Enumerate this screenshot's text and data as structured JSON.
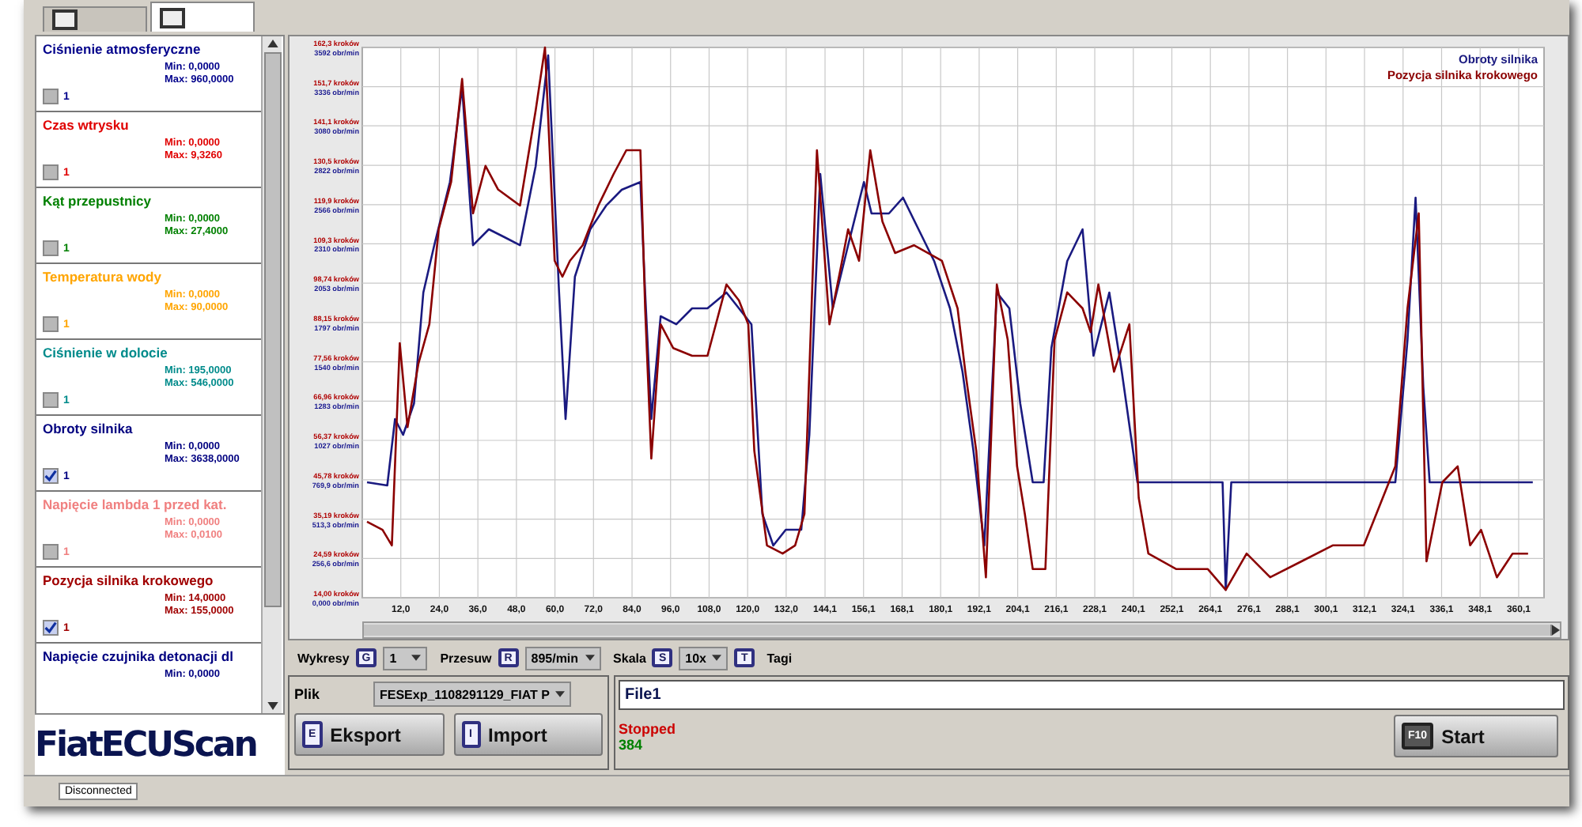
{
  "tabs": [
    {
      "selected": false
    },
    {
      "selected": true
    }
  ],
  "sensors": [
    {
      "name": "Ciśnienie atmosferyczne",
      "color": "#00008b",
      "min": "Min: 0,0000",
      "max": "Max: 960,0000",
      "checked": false,
      "channel": "1"
    },
    {
      "name": "Czas wtrysku",
      "color": "#e00000",
      "min": "Min: 0,0000",
      "max": "Max: 9,3260",
      "checked": false,
      "channel": "1"
    },
    {
      "name": "Kąt przepustnicy",
      "color": "#008000",
      "min": "Min: 0,0000",
      "max": "Max: 27,4000",
      "checked": false,
      "channel": "1"
    },
    {
      "name": "Temperatura wody",
      "color": "#ffa500",
      "min": "Min: 0,0000",
      "max": "Max: 90,0000",
      "checked": false,
      "channel": "1"
    },
    {
      "name": "Ciśnienie w dolocie",
      "color": "#008b8b",
      "min": "Min: 195,0000",
      "max": "Max: 546,0000",
      "checked": false,
      "channel": "1"
    },
    {
      "name": "Obroty silnika",
      "color": "#000080",
      "min": "Min: 0,0000",
      "max": "Max: 3638,0000",
      "checked": true,
      "channel": "1"
    },
    {
      "name": "Napięcie lambda 1 przed kat.",
      "color": "#f08080",
      "min": "Min: 0,0000",
      "max": "Max: 0,0100",
      "checked": false,
      "channel": "1"
    },
    {
      "name": "Pozycja silnika krokowego",
      "color": "#a00000",
      "min": "Min: 14,0000",
      "max": "Max: 155,0000",
      "checked": true,
      "channel": "1"
    },
    {
      "name": "Napięcie czujnika detonacji dl",
      "color": "#000080",
      "min": "Min: 0,0000"
    }
  ],
  "logo": "FiatECUScan",
  "chart": {
    "chart_data": {
      "type": "line",
      "grid": true,
      "xlim": [
        0,
        368
      ],
      "ylim": [
        0,
        3592
      ],
      "y2lim": [
        14,
        162.3
      ],
      "xticks": [
        {
          "value": 12,
          "label": "12,0"
        },
        {
          "value": 24,
          "label": "24,0"
        },
        {
          "value": 36,
          "label": "36,0"
        },
        {
          "value": 48,
          "label": "48,0"
        },
        {
          "value": 60,
          "label": "60,0"
        },
        {
          "value": 72,
          "label": "72,0"
        },
        {
          "value": 84,
          "label": "84,0"
        },
        {
          "value": 96,
          "label": "96,0"
        },
        {
          "value": 108,
          "label": "108,0"
        },
        {
          "value": 120,
          "label": "120,0"
        },
        {
          "value": 132,
          "label": "132,0"
        },
        {
          "value": 144.1,
          "label": "144,1"
        },
        {
          "value": 156.1,
          "label": "156,1"
        },
        {
          "value": 168.1,
          "label": "168,1"
        },
        {
          "value": 180.1,
          "label": "180,1"
        },
        {
          "value": 192.1,
          "label": "192,1"
        },
        {
          "value": 204.1,
          "label": "204,1"
        },
        {
          "value": 216.1,
          "label": "216,1"
        },
        {
          "value": 228.1,
          "label": "228,1"
        },
        {
          "value": 240.1,
          "label": "240,1"
        },
        {
          "value": 252.1,
          "label": "252,1"
        },
        {
          "value": 264.1,
          "label": "264,1"
        },
        {
          "value": 276.1,
          "label": "276,1"
        },
        {
          "value": 288.1,
          "label": "288,1"
        },
        {
          "value": 300.1,
          "label": "300,1"
        },
        {
          "value": 312.1,
          "label": "312,1"
        },
        {
          "value": 324.1,
          "label": "324,1"
        },
        {
          "value": 336.1,
          "label": "336,1"
        },
        {
          "value": 348.1,
          "label": "348,1"
        },
        {
          "value": 360.1,
          "label": "360,1"
        }
      ],
      "yticks": [
        {
          "value": 0,
          "label": "0,000 obr/min"
        },
        {
          "value": 256.6,
          "label": "256,6 obr/min"
        },
        {
          "value": 513.3,
          "label": "513,3 obr/min"
        },
        {
          "value": 769.9,
          "label": "769,9 obr/min"
        },
        {
          "value": 1027,
          "label": "1027 obr/min"
        },
        {
          "value": 1283,
          "label": "1283 obr/min"
        },
        {
          "value": 1540,
          "label": "1540 obr/min"
        },
        {
          "value": 1797,
          "label": "1797 obr/min"
        },
        {
          "value": 2053,
          "label": "2053 obr/min"
        },
        {
          "value": 2310,
          "label": "2310 obr/min"
        },
        {
          "value": 2566,
          "label": "2566 obr/min"
        },
        {
          "value": 2822,
          "label": "2822 obr/min"
        },
        {
          "value": 3080,
          "label": "3080 obr/min"
        },
        {
          "value": 3336,
          "label": "3336 obr/min"
        },
        {
          "value": 3592,
          "label": "3592 obr/min"
        }
      ],
      "y2ticks": [
        {
          "value": 14,
          "label": "14,00 kroków"
        },
        {
          "value": 24.59,
          "label": "24,59 kroków"
        },
        {
          "value": 35.19,
          "label": "35,19 kroków"
        },
        {
          "value": 45.78,
          "label": "45,78 kroków"
        },
        {
          "value": 56.37,
          "label": "56,37 kroków"
        },
        {
          "value": 66.96,
          "label": "66,96 kroków"
        },
        {
          "value": 77.56,
          "label": "77,56 kroków"
        },
        {
          "value": 88.15,
          "label": "88,15 kroków"
        },
        {
          "value": 98.74,
          "label": "98,74 kroków"
        },
        {
          "value": 109.3,
          "label": "109,3 kroków"
        },
        {
          "value": 119.9,
          "label": "119,9 kroków"
        },
        {
          "value": 130.5,
          "label": "130,5 kroków"
        },
        {
          "value": 141.1,
          "label": "141,1 kroków"
        },
        {
          "value": 151.7,
          "label": "151,7 kroków"
        },
        {
          "value": 162.3,
          "label": "162,3 kroków"
        }
      ],
      "series": [
        {
          "name": "Obroty silnika",
          "color": "#1a1a80",
          "x": [
            1.5,
            7.8,
            10.2,
            12.7,
            16.1,
            19,
            22.4,
            27.3,
            31.1,
            34.5,
            39.4,
            44.3,
            49.1,
            54,
            57.9,
            61.3,
            63.3,
            66.2,
            71,
            75.9,
            80.8,
            86.6,
            88.1,
            90,
            92.9,
            97.8,
            102.7,
            107.5,
            113.4,
            117.3,
            121.2,
            124.6,
            128,
            131.9,
            136.7,
            139.2,
            142.6,
            146.5,
            151.3,
            156.2,
            158.6,
            164,
            168.4,
            173.2,
            178.1,
            183,
            186.9,
            190.3,
            193.7,
            197.6,
            201.5,
            204.9,
            208.8,
            212.2,
            214.6,
            219.5,
            224.3,
            227.7,
            232.6,
            236.5,
            241.4,
            248.7,
            263.3,
            267.9,
            268.9,
            270.6,
            282.7,
            297.3,
            311.9,
            321.7,
            325.5,
            328,
            330.4,
            332.4,
            341.1,
            350.9,
            364.5
          ],
          "values": [
            753,
            733,
            1166,
            1063,
            1269,
            1992,
            2301,
            2714,
            3333,
            2301,
            2405,
            2353,
            2301,
            2817,
            3540,
            1992,
            1166,
            2095,
            2405,
            2559,
            2663,
            2714,
            1992,
            1166,
            1837,
            1785,
            1889,
            1889,
            1992,
            1889,
            1785,
            547,
            341,
            444,
            444,
            1063,
            2766,
            1889,
            2301,
            2714,
            2508,
            2508,
            2611,
            2405,
            2198,
            1889,
            1476,
            960,
            341,
            1992,
            1889,
            1269,
            753,
            753,
            1631,
            2198,
            2405,
            1579,
            1992,
            1476,
            753,
            753,
            753,
            753,
            52,
            753,
            753,
            753,
            753,
            753,
            1682,
            2611,
            1373,
            753,
            753,
            753,
            753
          ]
        },
        {
          "name": "Pozycja silnika krokowego",
          "color": "#8b0000",
          "axis": "y2",
          "x": [
            1.5,
            6.3,
            9.2,
            11.7,
            14.1,
            17.5,
            20.9,
            23.8,
            27.7,
            31.1,
            34.5,
            38.4,
            42.3,
            49.1,
            54,
            56.9,
            59.9,
            62.3,
            64.7,
            68.6,
            73.5,
            78.3,
            82.2,
            86.6,
            88.1,
            90,
            92.9,
            96.8,
            102.7,
            107.5,
            113.4,
            117.3,
            120.2,
            122.1,
            126,
            130.9,
            134.8,
            137.7,
            141.6,
            145.5,
            148.9,
            151.3,
            154.7,
            158.2,
            162,
            165.9,
            171.8,
            180.5,
            185.4,
            187.8,
            191.2,
            194.2,
            197.6,
            201,
            203.9,
            206.3,
            208.8,
            212.7,
            215.6,
            219.5,
            224.3,
            226.8,
            229.2,
            234.1,
            238.9,
            241.8,
            244.8,
            253.5,
            263.3,
            268.9,
            275.4,
            282.7,
            292.5,
            302.2,
            311.9,
            321.7,
            325.5,
            329,
            331.4,
            336.3,
            341.1,
            345,
            348.4,
            353.3,
            358.2,
            363
          ],
          "values": [
            34.5,
            32.3,
            28.1,
            82.6,
            60,
            77.1,
            87.7,
            113.3,
            126.1,
            153.8,
            117.6,
            130.4,
            124,
            119.7,
            145.3,
            162.3,
            104.8,
            100.5,
            104.8,
            109,
            119.7,
            128.2,
            134.6,
            134.6,
            92,
            51.5,
            87.7,
            81.3,
            79.2,
            79.2,
            98.4,
            94.1,
            87.7,
            53.6,
            28.1,
            25.9,
            28.1,
            36.6,
            134.6,
            87.7,
            102.6,
            113.3,
            104.8,
            134.6,
            115.4,
            106.9,
            109,
            104.8,
            92,
            74.9,
            53.6,
            19.5,
            98.4,
            83.5,
            49.4,
            36.6,
            21.7,
            21.7,
            83.5,
            96.3,
            92,
            85.6,
            98.4,
            74.9,
            87.7,
            40.9,
            25.9,
            21.7,
            21.7,
            16.1,
            25.9,
            19.5,
            23.8,
            28.1,
            28.1,
            49.4,
            92,
            117.6,
            23.8,
            45.1,
            49.4,
            28.1,
            32.3,
            19.5,
            25.9,
            25.9
          ]
        }
      ]
    }
  },
  "controls": [
    {
      "kind": "select",
      "label": "Wykresy",
      "key": "G",
      "value": "1"
    },
    {
      "kind": "select",
      "label": "Przesuw",
      "key": "R",
      "value": "895/min"
    },
    {
      "kind": "select",
      "label": "Skala",
      "key": "S",
      "value": "10x"
    },
    {
      "kind": "toggle",
      "key": "T",
      "label": "Tagi"
    }
  ],
  "file": {
    "label": "Plik",
    "value": "FESExp_1108291129_FIAT P"
  },
  "buttons": [
    {
      "key": "E",
      "label": "Eksport"
    },
    {
      "key": "I",
      "label": "Import"
    }
  ],
  "file_name": "File1",
  "status": "Stopped",
  "count": "384",
  "start_button": {
    "key": "F10",
    "label": "Start"
  },
  "status_bar": "Disconnected"
}
